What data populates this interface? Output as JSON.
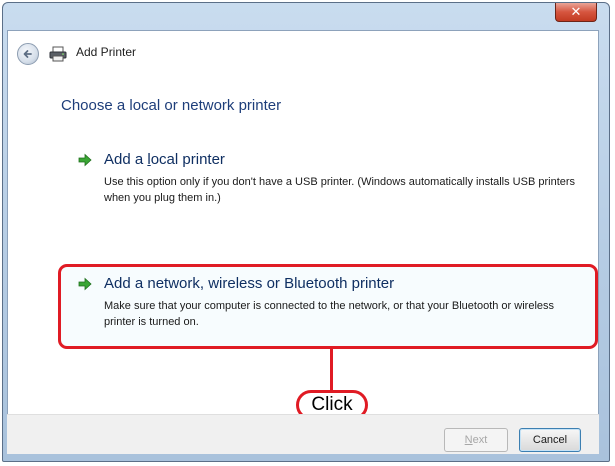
{
  "window": {
    "title": "Add Printer",
    "close_label": "✕"
  },
  "wizard": {
    "heading": "Choose a local or network printer",
    "options": [
      {
        "title_pre": "Add a ",
        "title_accel": "l",
        "title_post": "ocal printer",
        "description": "Use this option only if you don't have a USB printer. (Windows automatically installs USB printers when you plug them in.)"
      },
      {
        "title": "Add a network, wireless or Bluetooth printer",
        "description": "Make sure that your computer is connected to the network, or that your Bluetooth or wireless printer is turned on."
      }
    ]
  },
  "annotation": {
    "callout_label": "Click",
    "highlight_color": "#e01b24"
  },
  "footer": {
    "next_accel": "N",
    "next_rest": "ext",
    "next_enabled": false,
    "cancel_label": "Cancel"
  },
  "icons": {
    "back": "back-arrow-icon",
    "printer": "printer-icon",
    "option_arrow": "green-arrow-icon",
    "close": "close-icon"
  }
}
